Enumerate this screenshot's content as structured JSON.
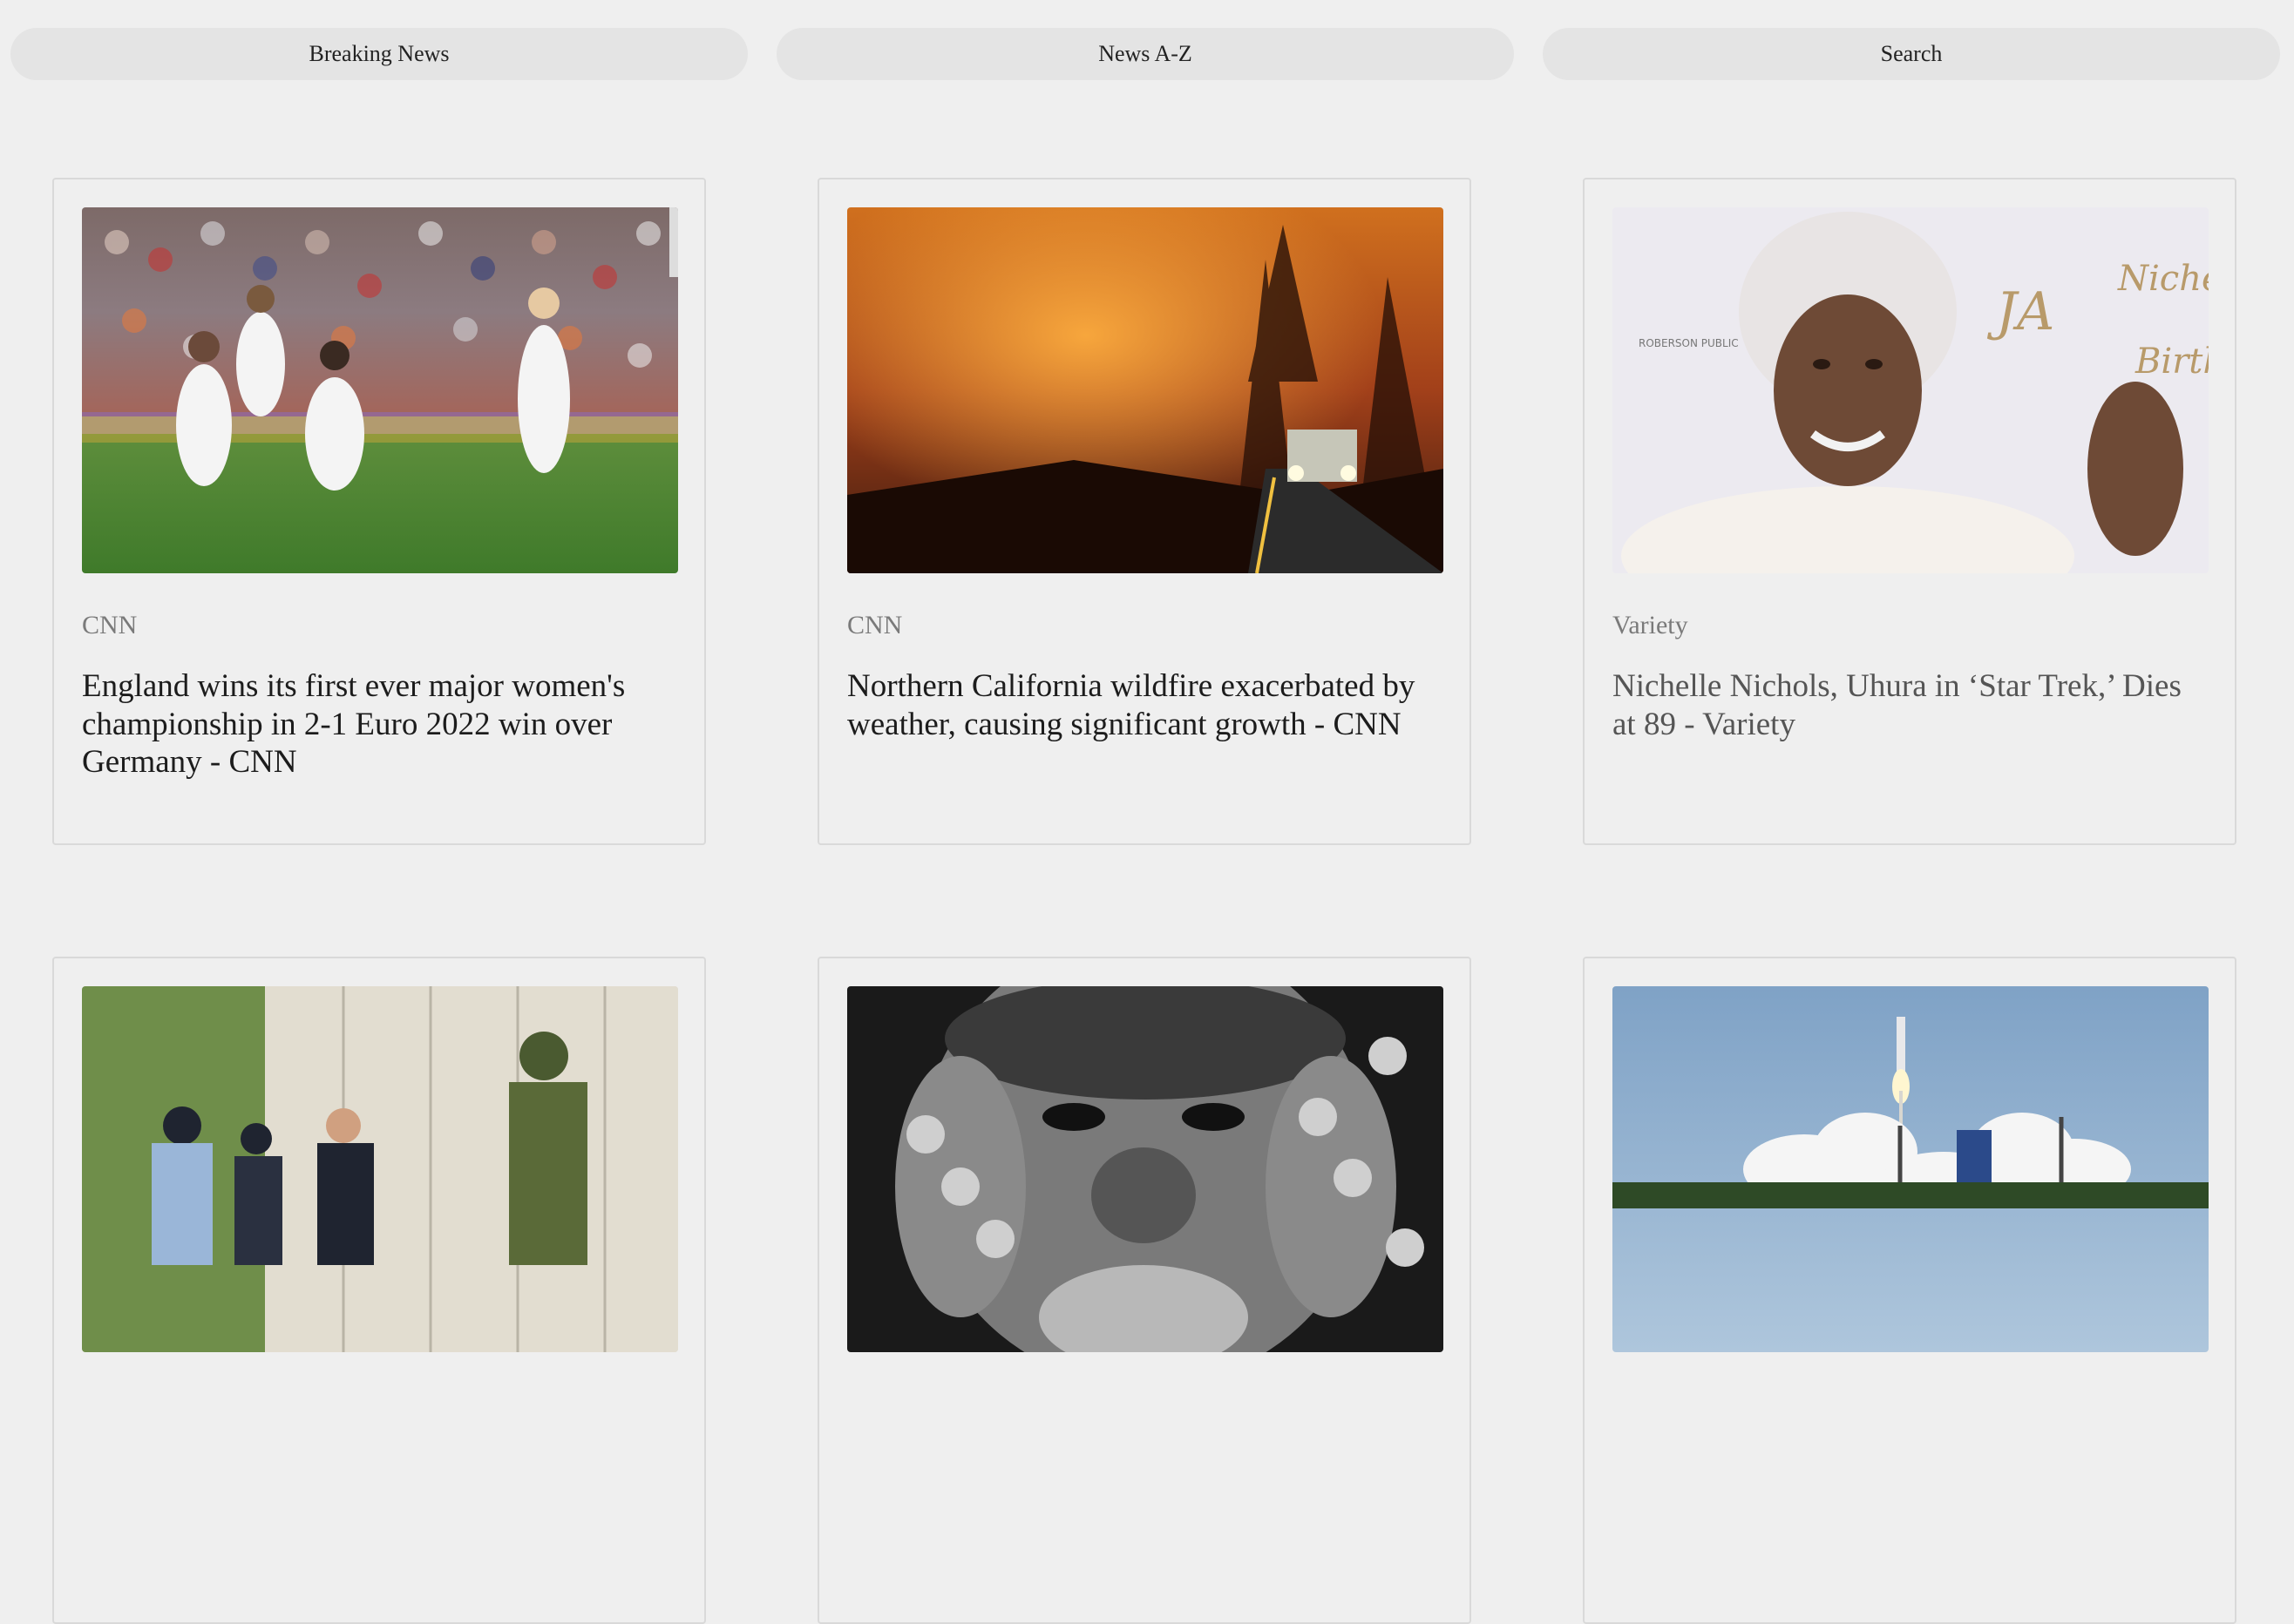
{
  "nav": {
    "items": [
      {
        "label": "Breaking News"
      },
      {
        "label": "News A-Z"
      },
      {
        "label": "Search"
      }
    ]
  },
  "articles": [
    {
      "source": "CNN",
      "headline": "England wins its first ever major women's championship in 2-1 Euro 2022 win over Germany - CNN",
      "image": "soccer-celebration-photo"
    },
    {
      "source": "CNN",
      "headline": "Northern California wildfire exacerbated by weather, causing significant growth - CNN",
      "image": "wildfire-road-photo"
    },
    {
      "source": "Variety",
      "headline": "Nichelle Nichols, Uhura in ‘Star Trek,’ Dies at 89 - Variety",
      "image": "portrait-waving-photo"
    },
    {
      "source": "",
      "headline": "",
      "image": "soldiers-street-photo"
    },
    {
      "source": "",
      "headline": "",
      "image": "bw-portrait-rings-photo"
    },
    {
      "source": "",
      "headline": "",
      "image": "rocket-launch-photo"
    }
  ],
  "colors": {
    "background": "#efefef",
    "nav_button": "#e4e4e4",
    "card_border": "#d9d9d9",
    "source_text": "#7a7a7a"
  }
}
